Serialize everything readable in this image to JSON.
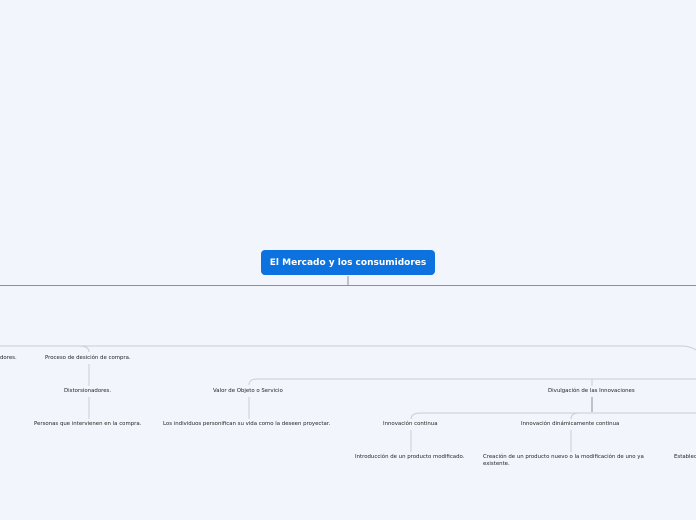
{
  "mindmap": {
    "central_topic": "El Mercado y los consumidores",
    "nodes": {
      "edge_left_fragment": "dores.",
      "proceso": "Proceso de desición de compra.",
      "distorsionadores": "Distorsionadores.",
      "personas": "Personas que intervienen en la compra.",
      "valor": "Valor de Objeto o Servicio",
      "individuos": "Los individuos personifican su vida como la deseen proyectar.",
      "divulgacion": "Divulgación de las Innovaciones",
      "innovacion_continua": "Innovación continua",
      "introduccion": "Introducción de un producto modificado.",
      "innovacion_dinamica": "Innovación dinámicamente continua",
      "creacion": "Creación de un producto nuevo o la modificación de uno ya existente.",
      "edge_right_fragment": "Establec"
    }
  },
  "colors": {
    "background": "#f3f5fc",
    "root_fill": "#0b72e0",
    "root_text": "#ffffff",
    "connector": "#c9cdd6",
    "main_line": "#8d9096"
  }
}
